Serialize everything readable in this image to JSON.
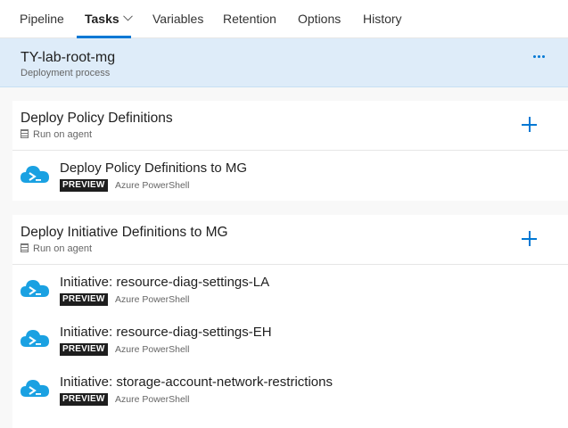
{
  "tabs": [
    {
      "label": "Pipeline"
    },
    {
      "label": "Tasks",
      "active": true
    },
    {
      "label": "Variables"
    },
    {
      "label": "Retention"
    },
    {
      "label": "Options"
    },
    {
      "label": "History"
    }
  ],
  "stage": {
    "title": "TY-lab-root-mg",
    "subtitle": "Deployment process"
  },
  "jobs": [
    {
      "title": "Deploy Policy Definitions",
      "agent_label": "Run on agent",
      "tasks": [
        {
          "title": "Deploy Policy Definitions to MG",
          "badge": "PREVIEW",
          "kind": "Azure PowerShell"
        }
      ]
    },
    {
      "title": "Deploy Initiative Definitions to MG",
      "agent_label": "Run on agent",
      "tasks": [
        {
          "title": "Initiative: resource-diag-settings-LA",
          "badge": "PREVIEW",
          "kind": "Azure PowerShell"
        },
        {
          "title": "Initiative: resource-diag-settings-EH",
          "badge": "PREVIEW",
          "kind": "Azure PowerShell"
        },
        {
          "title": "Initiative: storage-account-network-restrictions",
          "badge": "PREVIEW",
          "kind": "Azure PowerShell"
        }
      ]
    }
  ],
  "colors": {
    "accent": "#0078d4",
    "stage_bg": "#deecf9",
    "cloud": "#1aa1e2",
    "badge_bg": "#1e1e1e"
  },
  "icons": {
    "more": "ellipsis-icon",
    "add": "plus-icon",
    "agent": "server-icon",
    "task": "azure-powershell-cloud-icon",
    "tab_dropdown": "chevron-down-icon"
  }
}
